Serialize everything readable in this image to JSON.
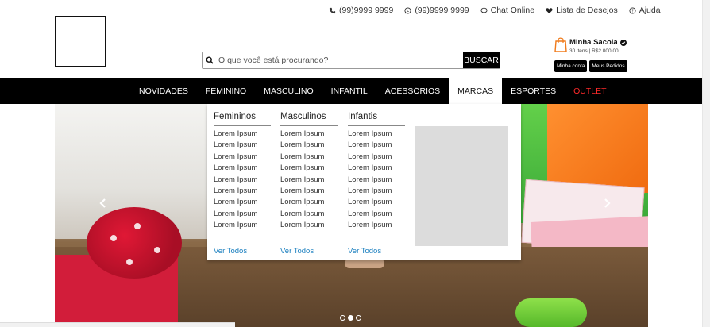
{
  "topbar": {
    "phone": "(99)9999 9999",
    "whatsapp": "(99)9999 9999",
    "chat": "Chat Online",
    "wishlist": "Lista de Desejos",
    "help": "Ajuda",
    "icons": [
      "phone-icon",
      "whatsapp-icon",
      "chat-icon",
      "heart-icon",
      "help-icon"
    ]
  },
  "search": {
    "placeholder": "O que você está procurando?",
    "button": "BUSCAR"
  },
  "bag": {
    "title": "Minha Sacola",
    "summary": "30 itens | R$2.000,00",
    "account": "Minha conta",
    "orders": "Meus Pedidos",
    "accent": "#f07a1a"
  },
  "nav": {
    "items": [
      {
        "label": "NOVIDADES"
      },
      {
        "label": "FEMININO"
      },
      {
        "label": "MASCULINO"
      },
      {
        "label": "INFANTIL"
      },
      {
        "label": "ACESSÓRIOS"
      },
      {
        "label": "MARCAS"
      },
      {
        "label": "ESPORTES"
      },
      {
        "label": "OUTLET"
      }
    ],
    "active": "MARCAS",
    "outlet_color": "#ff2a2a"
  },
  "mega": {
    "columns": [
      {
        "title": "Femininos",
        "items": [
          "Lorem Ipsum",
          "Lorem Ipsum",
          "Lorem Ipsum",
          "Lorem Ipsum",
          "Lorem Ipsum",
          "Lorem Ipsum",
          "Lorem Ipsum",
          "Lorem Ipsum",
          "Lorem Ipsum"
        ],
        "all": "Ver Todos"
      },
      {
        "title": "Masculinos",
        "items": [
          "Lorem Ipsum",
          "Lorem Ipsum",
          "Lorem Ipsum",
          "Lorem Ipsum",
          "Lorem Ipsum",
          "Lorem Ipsum",
          "Lorem Ipsum",
          "Lorem Ipsum",
          "Lorem Ipsum"
        ],
        "all": "Ver Todos"
      },
      {
        "title": "Infantis",
        "items": [
          "Lorem Ipsum",
          "Lorem Ipsum",
          "Lorem Ipsum",
          "Lorem Ipsum",
          "Lorem Ipsum",
          "Lorem Ipsum",
          "Lorem Ipsum",
          "Lorem Ipsum",
          "Lorem Ipsum"
        ],
        "all": "Ver Todos"
      }
    ],
    "link_color": "#1a7fbf"
  },
  "carousel": {
    "slides": 3,
    "active": 2
  }
}
